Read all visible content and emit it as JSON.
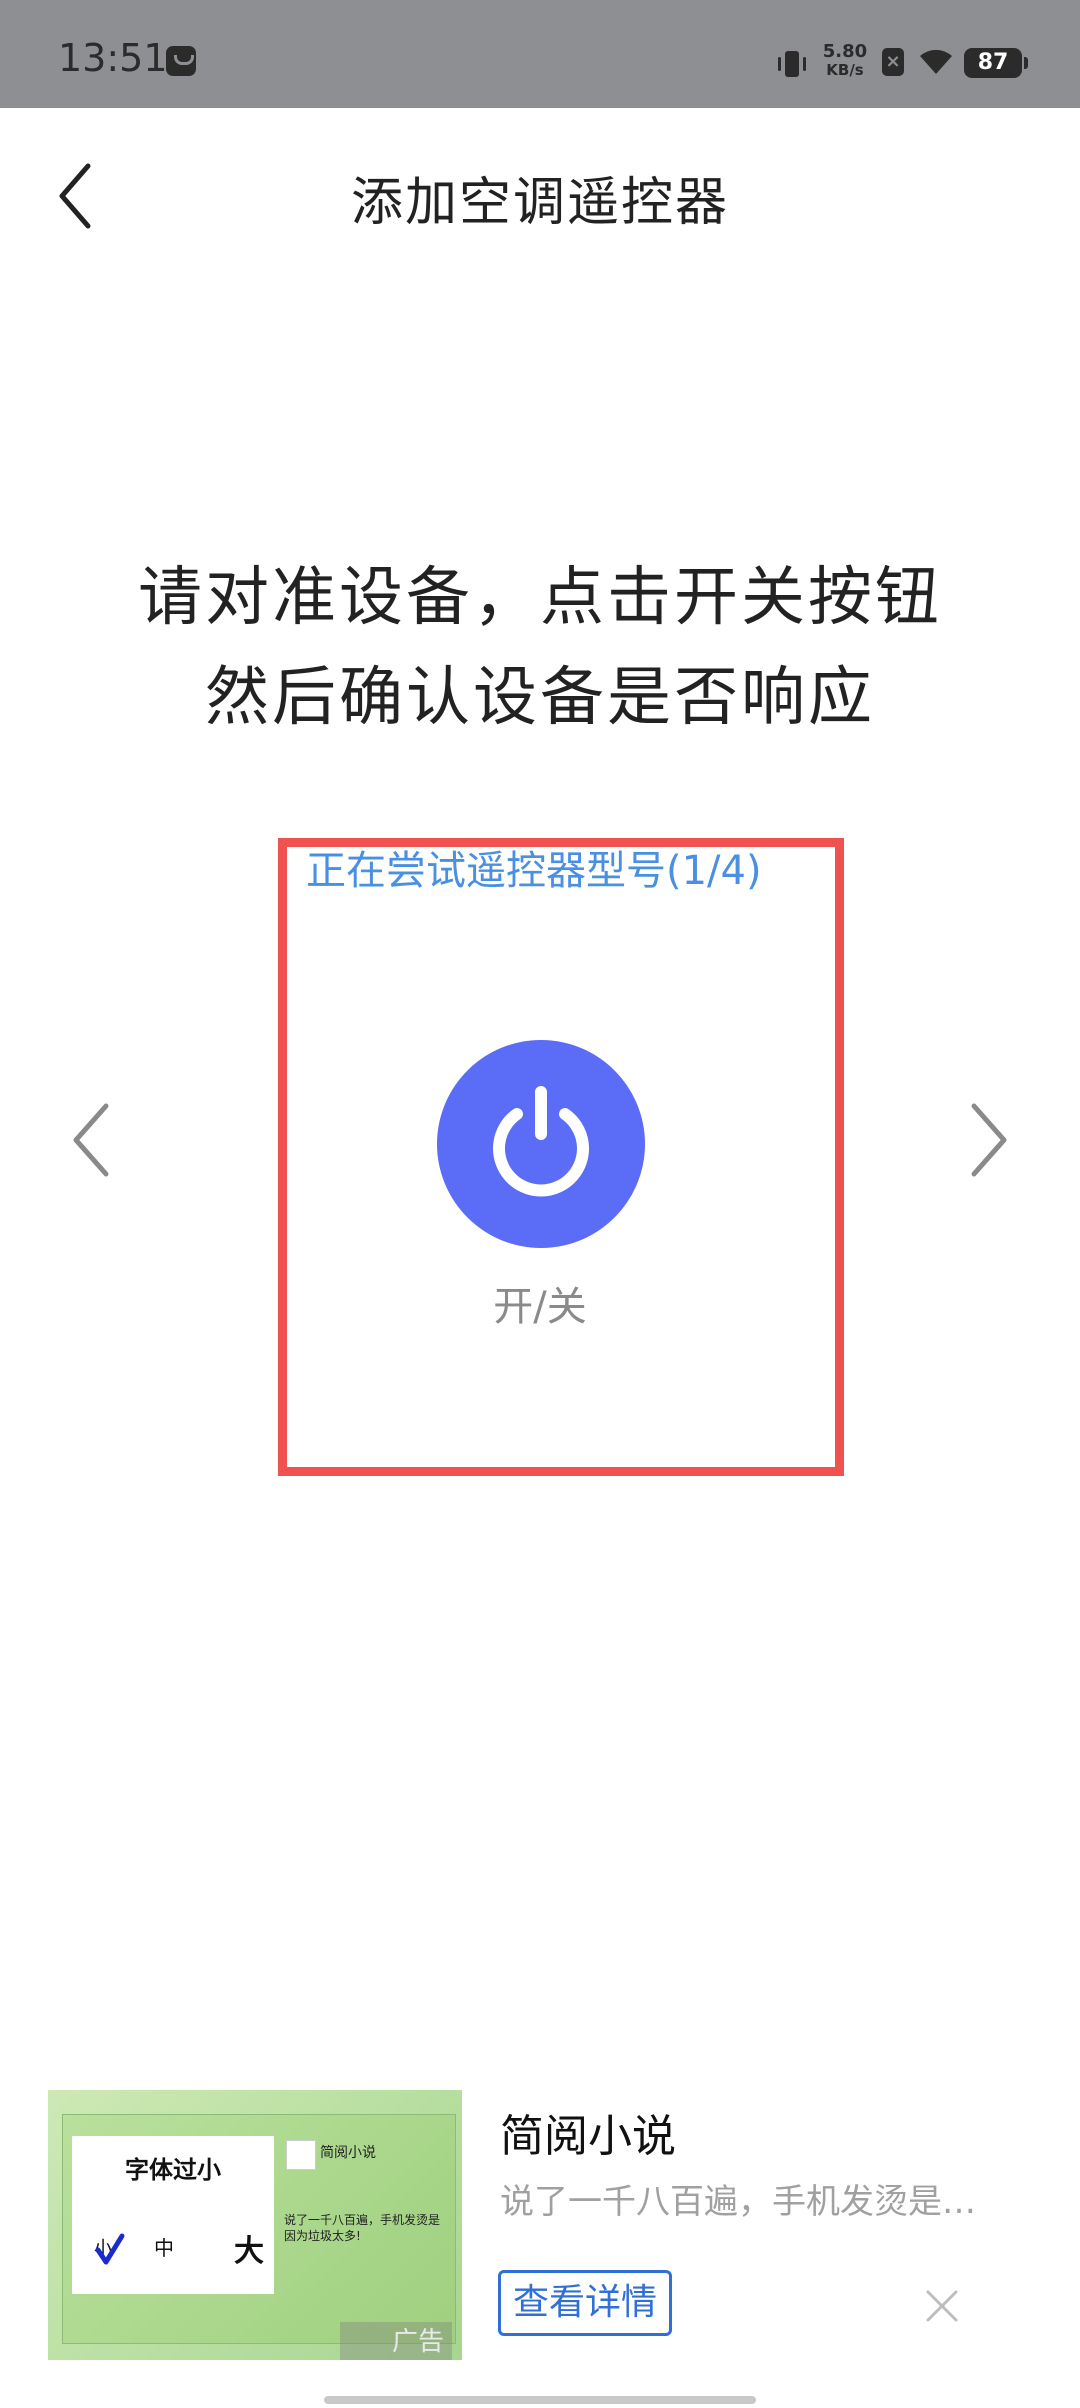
{
  "status_bar": {
    "time": "13:51",
    "net_speed_value": "5.80",
    "net_speed_unit": "KB/s",
    "battery": "87"
  },
  "header": {
    "title": "添加空调遥控器"
  },
  "instruction": {
    "line1": "请对准设备，点击开关按钮",
    "line2": "然后确认设备是否响应"
  },
  "remote_trial": {
    "status": "正在尝试遥控器型号(1/4)",
    "power_label": "开/关"
  },
  "colors": {
    "highlight": "#f0524f",
    "power_button": "#5b6cf7",
    "link_blue": "#4a90e2"
  },
  "ad": {
    "title": "简阅小说",
    "description": "说了一千八百遍，手机发烫是…",
    "button": "查看详情",
    "tag": "广告",
    "image": {
      "card_title": "字体过小",
      "size_small": "小",
      "size_mid": "中",
      "size_big": "大",
      "brand": "简阅小说",
      "caption": "说了一千八百遍，手机发烫是因为垃圾太多!"
    }
  }
}
